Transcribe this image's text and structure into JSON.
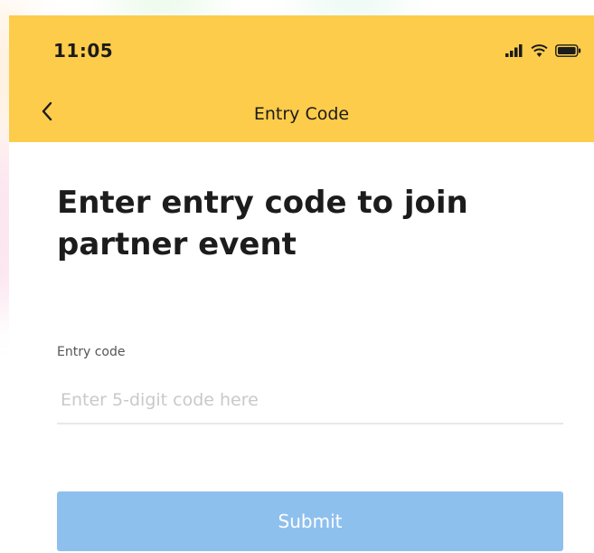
{
  "status_bar": {
    "time": "11:05",
    "signal_icon": "cellular-signal-icon",
    "wifi_icon": "wifi-icon",
    "battery_icon": "battery-icon"
  },
  "nav": {
    "back_icon": "chevron-left-icon",
    "title": "Entry Code"
  },
  "main": {
    "headline": "Enter entry code to join partner event",
    "field": {
      "label": "Entry code",
      "placeholder": "Enter 5-digit code here",
      "value": ""
    },
    "submit_label": "Submit"
  },
  "colors": {
    "header_bg": "#FDCC4B",
    "submit_bg": "#8EC0EE",
    "text_dark": "#1c1c1c"
  }
}
